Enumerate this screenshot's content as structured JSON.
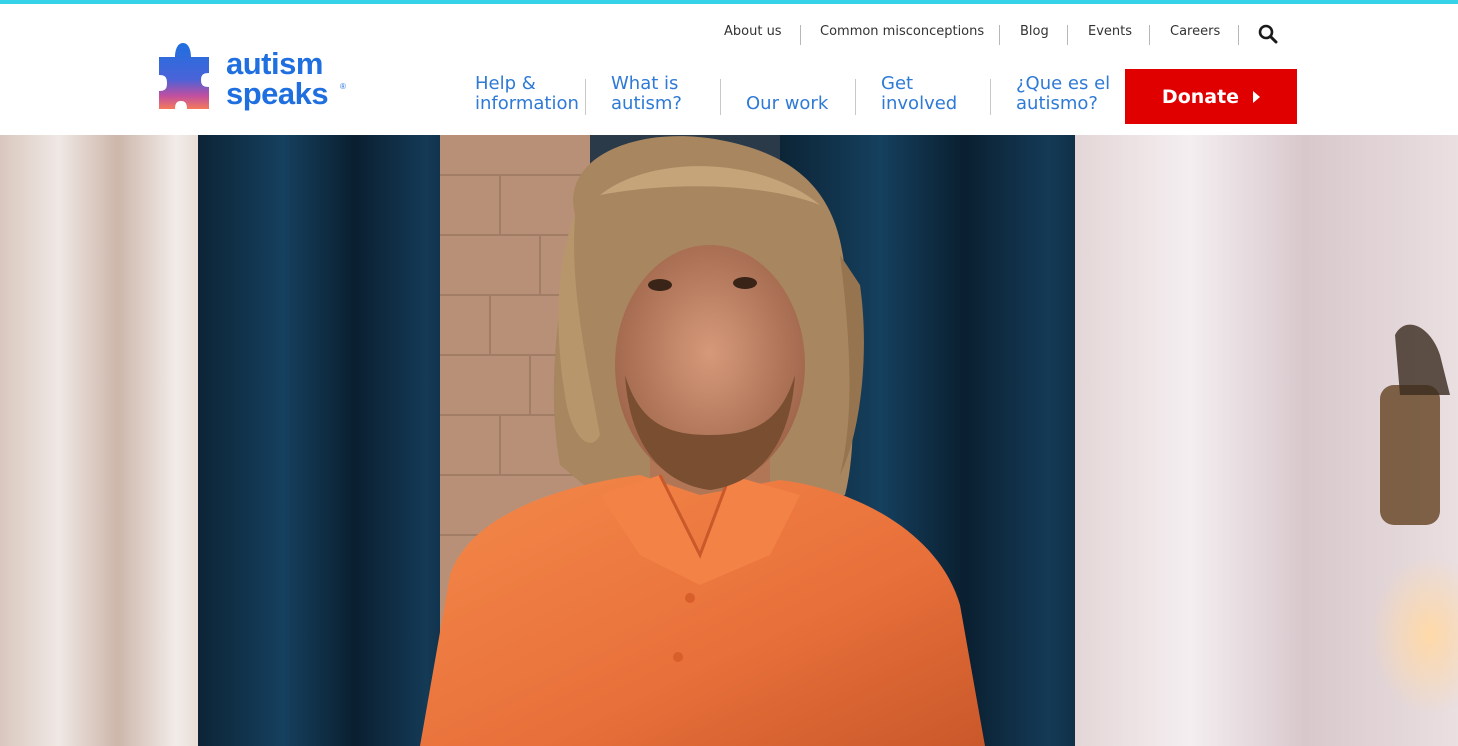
{
  "brand": {
    "line1": "autism",
    "line2": "speaks",
    "registered": "®",
    "colors": {
      "cyan_bar": "#36d2e8",
      "blue": "#2e7ad6",
      "donate_red": "#e00000"
    }
  },
  "utility_nav": {
    "items": [
      "About us",
      "Common misconceptions",
      "Blog",
      "Events",
      "Careers"
    ],
    "search_icon": "search-icon"
  },
  "main_nav": {
    "items": [
      {
        "line1": "Help &",
        "line2": "information"
      },
      {
        "line1": "What is",
        "line2": "autism?"
      },
      {
        "line1": "",
        "line2": "Our work"
      },
      {
        "line1": "Get",
        "line2": "involved"
      },
      {
        "line1": "¿Que es el",
        "line2": "autismo?"
      }
    ],
    "donate_label": "Donate"
  },
  "hero": {
    "subject": "Man with long reddish-blond hair and beard in an orange polo shirt",
    "colors": {
      "curtain": "#103048",
      "shirt": "#f07838",
      "drape": "#e7e0de"
    }
  }
}
